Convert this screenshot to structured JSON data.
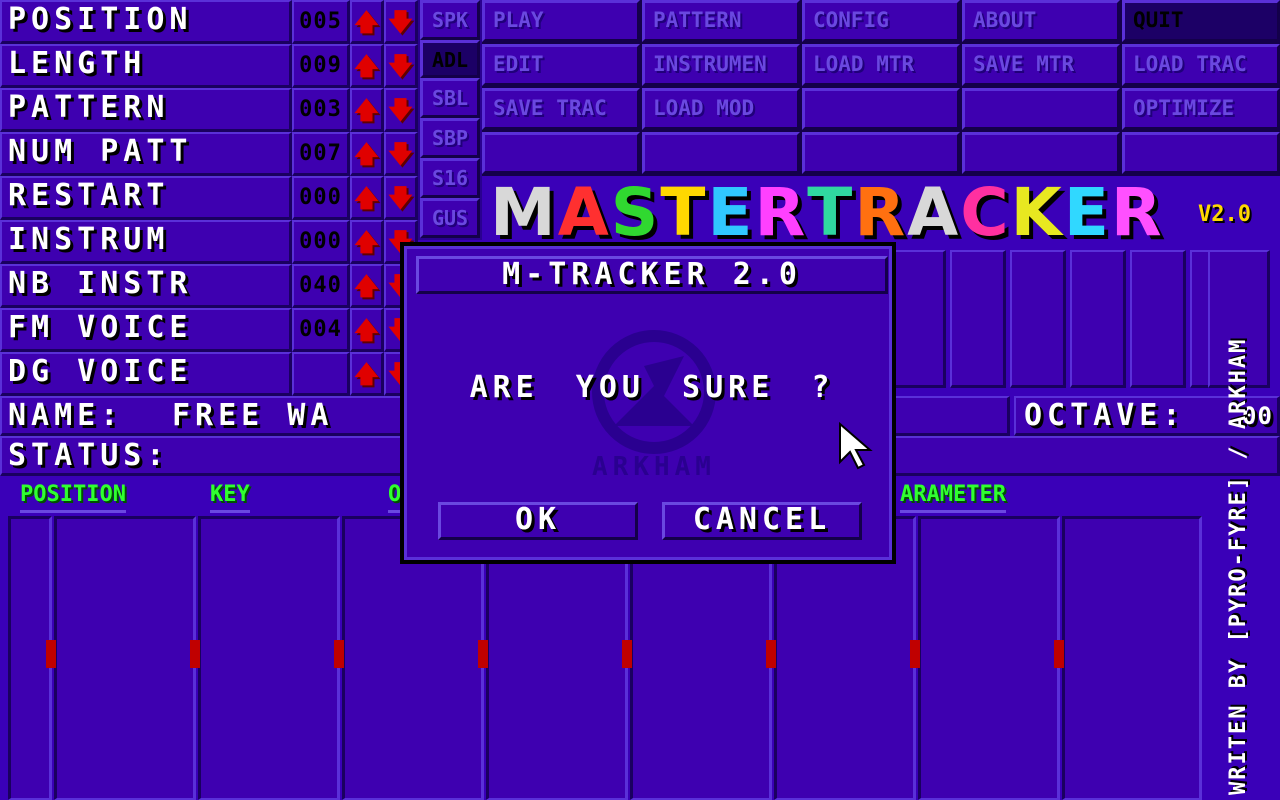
{
  "left_panel": {
    "rows": [
      {
        "label": "POSITION",
        "value": "005"
      },
      {
        "label": "LENGTH",
        "value": "009"
      },
      {
        "label": "PATTERN",
        "value": "003"
      },
      {
        "label": "NUM PATT",
        "value": "007"
      },
      {
        "label": "RESTART",
        "value": "000"
      },
      {
        "label": "INSTRUM",
        "value": "000"
      },
      {
        "label": "NB INSTR",
        "value": "040"
      },
      {
        "label": "FM VOICE",
        "value": "004"
      },
      {
        "label": "DG VOICE",
        "value": ""
      }
    ],
    "up_glyph": "🡅",
    "down_glyph": "🡇"
  },
  "sound_buttons": [
    "SPK",
    "ADL",
    "SBL",
    "SBP",
    "S16",
    "GUS"
  ],
  "menu": {
    "row1": [
      "PLAY",
      "PATTERN",
      "CONFIG",
      "ABOUT",
      "QUIT"
    ],
    "row2": [
      "EDIT",
      "INSTRUMEN",
      "LOAD MTR",
      "SAVE MTR",
      "LOAD TRAC"
    ],
    "row3": [
      "SAVE TRAC",
      "LOAD MOD",
      "",
      "",
      "OPTIMIZE"
    ],
    "row4": [
      "",
      "",
      "",
      "",
      ""
    ]
  },
  "logo": {
    "letters": [
      {
        "ch": "M",
        "color": "#d8d8d8"
      },
      {
        "ch": "A",
        "color": "#ff3030"
      },
      {
        "ch": "S",
        "color": "#30d830"
      },
      {
        "ch": "T",
        "color": "#ffd800"
      },
      {
        "ch": "E",
        "color": "#30c8ff"
      },
      {
        "ch": "R",
        "color": "#ff40ff"
      },
      {
        "ch": "T",
        "color": "#30d8a0"
      },
      {
        "ch": "R",
        "color": "#ff7010"
      },
      {
        "ch": "A",
        "color": "#d8d8d8"
      },
      {
        "ch": "C",
        "color": "#ff30a0"
      },
      {
        "ch": "K",
        "color": "#e8e820"
      },
      {
        "ch": "E",
        "color": "#30d8ff"
      },
      {
        "ch": "R",
        "color": "#ff50ff"
      }
    ],
    "version": "V2.0"
  },
  "info": {
    "name_label": "NAME:",
    "name_value": "FREE WA",
    "octave_label": "OCTAVE:",
    "octave_value": "00",
    "status_label": "STATUS:"
  },
  "tracker_headers": {
    "position": "POSITION",
    "key": "KEY",
    "octave": "O",
    "parameter": "ARAMETER"
  },
  "credits": "WRITEN BY [PYRO-FYRE] / ARKHAM",
  "dialog": {
    "title": "M-TRACKER 2.0",
    "message": "ARE YOU SURE ?",
    "watermark": "ARKHAM",
    "ok": "OK",
    "cancel": "CANCEL"
  },
  "colors": {
    "background": "#3a00b8",
    "active_button": "#1c0066",
    "header_green": "#30ff30",
    "marker_red": "#c00000"
  }
}
